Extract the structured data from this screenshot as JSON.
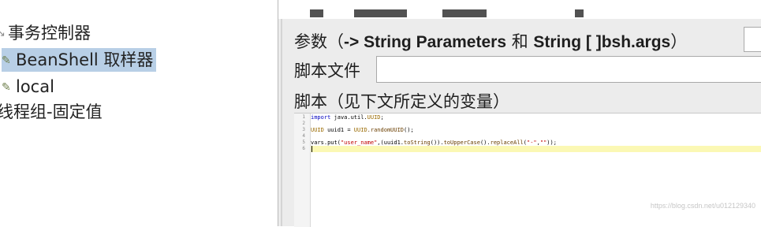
{
  "tree": {
    "items": [
      {
        "label": "事务控制器",
        "icon": "twig-icon"
      },
      {
        "label": "BeanShell 取样器",
        "icon": "pencil-icon",
        "selected": true
      },
      {
        "label": "local",
        "icon": "pencil-icon"
      },
      {
        "label": "线程组-固定值"
      }
    ]
  },
  "panel": {
    "params_label_prefix": "参数（",
    "params_label_bold1": "-> String Parameters",
    "params_label_mid": " 和 ",
    "params_label_bold2": "String [ ]bsh.args",
    "params_label_suffix": "）",
    "script_file_label": "脚本文件",
    "script_label": "脚本（见下文所定义的变量）"
  },
  "editor": {
    "line_numbers": [
      "1",
      "2",
      "3",
      "4",
      "5",
      "6"
    ],
    "lines": {
      "l1_kw": "import",
      "l1_rest": " java.util.",
      "l1_type": "UUID",
      "l1_end": ";",
      "l3_type1": "UUID",
      "l3_mid": " uuid1 = ",
      "l3_type2": "UUID",
      "l3_method": ".randomUUID",
      "l3_end": "();",
      "l5_start": "vars.put(",
      "l5_str1": "\"user_name\"",
      "l5_mid1": ",(uuid1.",
      "l5_m1": "toString",
      "l5_mid2": "()).",
      "l5_m2": "toUpperCase",
      "l5_mid3": "().",
      "l5_m3": "replaceAll",
      "l5_mid4": "(",
      "l5_str2": "\"-\"",
      "l5_comma": ",",
      "l5_str3": "\"\"",
      "l5_end": "));"
    }
  },
  "watermark": "https://blog.csdn.net/u012129340"
}
